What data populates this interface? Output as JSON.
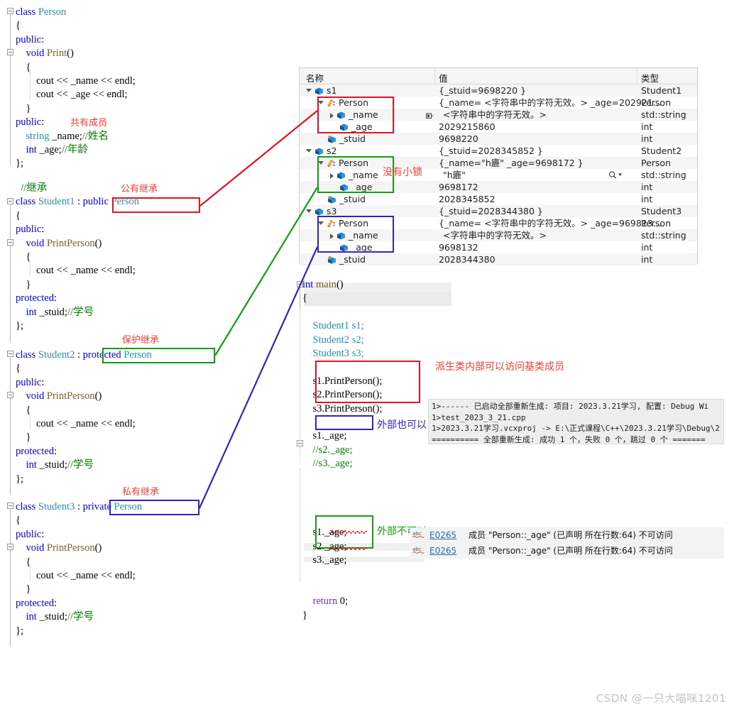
{
  "editor": {
    "left_code_blocks": [
      {
        "id": "person-class",
        "lines": [
          [
            {
              "t": "class ",
              "c": "kw"
            },
            {
              "t": "Person",
              "c": "type"
            }
          ],
          [
            {
              "t": "{",
              "c": "op"
            }
          ],
          [
            {
              "t": "public",
              "c": "kw"
            },
            {
              "t": ":",
              "c": "op"
            }
          ],
          [
            {
              "t": "    ",
              "c": "op"
            },
            {
              "t": "void ",
              "c": "kw"
            },
            {
              "t": "Print",
              "c": "fn"
            },
            {
              "t": "()",
              "c": "op"
            }
          ],
          [
            {
              "t": "    {",
              "c": "op"
            }
          ],
          [
            {
              "t": "        cout ",
              "c": "op"
            },
            {
              "t": "<<",
              "c": "op"
            },
            {
              "t": " _name ",
              "c": "op"
            },
            {
              "t": "<<",
              "c": "op"
            },
            {
              "t": " endl;",
              "c": "op"
            }
          ],
          [
            {
              "t": "        cout ",
              "c": "op"
            },
            {
              "t": "<<",
              "c": "op"
            },
            {
              "t": " _age ",
              "c": "op"
            },
            {
              "t": "<<",
              "c": "op"
            },
            {
              "t": " endl;",
              "c": "op"
            }
          ],
          [
            {
              "t": "    }",
              "c": "op"
            }
          ],
          [
            {
              "t": "public",
              "c": "kw"
            },
            {
              "t": ":",
              "c": "op"
            }
          ],
          [
            {
              "t": "    ",
              "c": "op"
            },
            {
              "t": "string",
              "c": "type"
            },
            {
              "t": " _name;",
              "c": "op"
            },
            {
              "t": "//姓名",
              "c": "cm"
            }
          ],
          [
            {
              "t": "    ",
              "c": "op"
            },
            {
              "t": "int",
              "c": "kw"
            },
            {
              "t": " _age;",
              "c": "op"
            },
            {
              "t": "//年龄",
              "c": "cm"
            }
          ],
          [
            {
              "t": "};",
              "c": "op"
            }
          ]
        ]
      },
      {
        "id": "student1-class",
        "lines": [
          [
            {
              "t": "  //继承",
              "c": "cm"
            }
          ],
          [
            {
              "t": "class ",
              "c": "kw"
            },
            {
              "t": "Student1",
              "c": "type"
            },
            {
              "t": " : ",
              "c": "op"
            },
            {
              "t": "public ",
              "c": "kw"
            },
            {
              "t": "Person",
              "c": "type"
            }
          ],
          [
            {
              "t": "{",
              "c": "op"
            }
          ],
          [
            {
              "t": "public",
              "c": "kw"
            },
            {
              "t": ":",
              "c": "op"
            }
          ],
          [
            {
              "t": "    ",
              "c": "op"
            },
            {
              "t": "void ",
              "c": "kw"
            },
            {
              "t": "PrintPerson",
              "c": "fn"
            },
            {
              "t": "()",
              "c": "op"
            }
          ],
          [
            {
              "t": "    {",
              "c": "op"
            }
          ],
          [
            {
              "t": "        cout ",
              "c": "op"
            },
            {
              "t": "<<",
              "c": "op"
            },
            {
              "t": " _name ",
              "c": "op"
            },
            {
              "t": "<<",
              "c": "op"
            },
            {
              "t": " endl;",
              "c": "op"
            }
          ],
          [
            {
              "t": "    }",
              "c": "op"
            }
          ],
          [
            {
              "t": "protected",
              "c": "kw"
            },
            {
              "t": ":",
              "c": "op"
            }
          ],
          [
            {
              "t": "    ",
              "c": "op"
            },
            {
              "t": "int",
              "c": "kw"
            },
            {
              "t": " _stuid;",
              "c": "op"
            },
            {
              "t": "//学号",
              "c": "cm"
            }
          ],
          [
            {
              "t": "};",
              "c": "op"
            }
          ]
        ]
      },
      {
        "id": "student2-class",
        "lines": [
          [
            {
              "t": "class ",
              "c": "kw"
            },
            {
              "t": "Student2",
              "c": "type"
            },
            {
              "t": " : ",
              "c": "op"
            },
            {
              "t": "protected ",
              "c": "kw"
            },
            {
              "t": "Person",
              "c": "type"
            }
          ],
          [
            {
              "t": "{",
              "c": "op"
            }
          ],
          [
            {
              "t": "public",
              "c": "kw"
            },
            {
              "t": ":",
              "c": "op"
            }
          ],
          [
            {
              "t": "    ",
              "c": "op"
            },
            {
              "t": "void ",
              "c": "kw"
            },
            {
              "t": "PrintPerson",
              "c": "fn"
            },
            {
              "t": "()",
              "c": "op"
            }
          ],
          [
            {
              "t": "    {",
              "c": "op"
            }
          ],
          [
            {
              "t": "        cout ",
              "c": "op"
            },
            {
              "t": "<<",
              "c": "op"
            },
            {
              "t": " _name ",
              "c": "op"
            },
            {
              "t": "<<",
              "c": "op"
            },
            {
              "t": " endl;",
              "c": "op"
            }
          ],
          [
            {
              "t": "    }",
              "c": "op"
            }
          ],
          [
            {
              "t": "protected",
              "c": "kw"
            },
            {
              "t": ":",
              "c": "op"
            }
          ],
          [
            {
              "t": "    ",
              "c": "op"
            },
            {
              "t": "int",
              "c": "kw"
            },
            {
              "t": " _stuid;",
              "c": "op"
            },
            {
              "t": "//学号",
              "c": "cm"
            }
          ],
          [
            {
              "t": "};",
              "c": "op"
            }
          ]
        ]
      },
      {
        "id": "student3-class",
        "lines": [
          [
            {
              "t": "class ",
              "c": "kw"
            },
            {
              "t": "Student3",
              "c": "type"
            },
            {
              "t": " : ",
              "c": "op"
            },
            {
              "t": "private ",
              "c": "kw"
            },
            {
              "t": "Person",
              "c": "type"
            }
          ],
          [
            {
              "t": "{",
              "c": "op"
            }
          ],
          [
            {
              "t": "public",
              "c": "kw"
            },
            {
              "t": ":",
              "c": "op"
            }
          ],
          [
            {
              "t": "    ",
              "c": "op"
            },
            {
              "t": "void ",
              "c": "kw"
            },
            {
              "t": "PrintPerson",
              "c": "fn"
            },
            {
              "t": "()",
              "c": "op"
            }
          ],
          [
            {
              "t": "    {",
              "c": "op"
            }
          ],
          [
            {
              "t": "        cout ",
              "c": "op"
            },
            {
              "t": "<<",
              "c": "op"
            },
            {
              "t": " _name ",
              "c": "op"
            },
            {
              "t": "<<",
              "c": "op"
            },
            {
              "t": " endl;",
              "c": "op"
            }
          ],
          [
            {
              "t": "    }",
              "c": "op"
            }
          ],
          [
            {
              "t": "protected",
              "c": "kw"
            },
            {
              "t": ":",
              "c": "op"
            }
          ],
          [
            {
              "t": "    ",
              "c": "op"
            },
            {
              "t": "int",
              "c": "kw"
            },
            {
              "t": " _stuid;",
              "c": "op"
            },
            {
              "t": "//学号",
              "c": "cm"
            }
          ],
          [
            {
              "t": "};",
              "c": "op"
            }
          ]
        ]
      }
    ],
    "main_block": {
      "signature_int": "int ",
      "signature_name": "main",
      "signature_parens": "()",
      "brace_open": "{",
      "decl1": "Student1 s1;",
      "decl2": "Student2 s2;",
      "decl3": "Student3 s3;",
      "call1": "s1.PrintPerson();",
      "call2": "s2.PrintPerson();",
      "call3": "s3.PrintPerson();",
      "access1": "s1._age;",
      "access2": "//s2._age;",
      "access3": "//s3._age;",
      "access4": "s1._age;",
      "access5": "s2._age;",
      "access6": "s3._age;",
      "return_kw": "return ",
      "return_val": "0;",
      "brace_close": "}"
    }
  },
  "annotations": {
    "public_inherit": "公有继承",
    "protected_inherit": "保护继承",
    "private_inherit": "私有继承",
    "public_member": "共有成员",
    "no_lock": "没有小锁",
    "derived_can_access": "派生类内部可以访问基类成员",
    "outside_can": "外部也可以",
    "outside_cannot": "外部不可以"
  },
  "watch_window": {
    "columns": {
      "name": "名称",
      "value": "值",
      "type": "类型"
    },
    "rows": [
      {
        "indent": 0,
        "exp": "open",
        "icon": "blue-cube",
        "name": "s1",
        "value": "{_stuid=9698220 }",
        "type": "Student1"
      },
      {
        "indent": 1,
        "exp": "open",
        "icon": "base-class",
        "name": "Person",
        "value": "{_name= <字符串中的字符无效。> _age=202921...",
        "type": "Person"
      },
      {
        "indent": 2,
        "exp": "closed",
        "icon": "blue-cube",
        "name": "_name",
        "value": "<字符串中的字符无效。>",
        "type": "std::string",
        "pin": true
      },
      {
        "indent": 2,
        "exp": "none",
        "icon": "blue-cube",
        "name": "_age",
        "value": "2029215860",
        "type": "int"
      },
      {
        "indent": 1,
        "exp": "none",
        "icon": "protected-cube",
        "name": "_stuid",
        "value": "9698220",
        "type": "int"
      },
      {
        "indent": 0,
        "exp": "open",
        "icon": "blue-cube",
        "name": "s2",
        "value": "{_stuid=2028345852 }",
        "type": "Student2"
      },
      {
        "indent": 1,
        "exp": "open",
        "icon": "base-class",
        "name": "Person",
        "value": "{_name=\"h廘\" _age=9698172 }",
        "type": "Person"
      },
      {
        "indent": 2,
        "exp": "closed",
        "icon": "blue-cube",
        "name": "_name",
        "value": "\"h廘\"",
        "type": "std::string",
        "magnifier": true
      },
      {
        "indent": 2,
        "exp": "none",
        "icon": "blue-cube",
        "name": "_age",
        "value": "9698172",
        "type": "int"
      },
      {
        "indent": 1,
        "exp": "none",
        "icon": "protected-cube",
        "name": "_stuid",
        "value": "2028345852",
        "type": "int"
      },
      {
        "indent": 0,
        "exp": "open",
        "icon": "blue-cube",
        "name": "s3",
        "value": "{_stuid=2028344380 }",
        "type": "Student3"
      },
      {
        "indent": 1,
        "exp": "open",
        "icon": "base-class",
        "name": "Person",
        "value": "{_name= <字符串中的字符无效。> _age=969813...",
        "type": "Person"
      },
      {
        "indent": 2,
        "exp": "closed",
        "icon": "blue-cube",
        "name": "_name",
        "value": "<字符串中的字符无效。>",
        "type": "std::string"
      },
      {
        "indent": 2,
        "exp": "none",
        "icon": "blue-cube",
        "name": "_age",
        "value": "9698132",
        "type": "int"
      },
      {
        "indent": 1,
        "exp": "none",
        "icon": "protected-cube",
        "name": "_stuid",
        "value": "2028344380",
        "type": "int"
      }
    ]
  },
  "output_window": {
    "lines": [
      "1>------ 已启动全部重新生成: 项目: 2023.3.21学习, 配置: Debug Wi",
      "1>test_2023_3_21.cpp",
      "1>2023.3.21学习.vcxproj -> E:\\正式课程\\C++\\2023.3.21学习\\Debug\\2",
      "========== 全部重新生成: 成功 1 个，失败 0 个，跳过 0 个 ======="
    ]
  },
  "error_list": {
    "rows": [
      {
        "icon": "squiggle-icon",
        "code": "E0265",
        "message": "成员 \"Person::_age\" (已声明 所在行数:64) 不可访问"
      },
      {
        "icon": "squiggle-icon",
        "code": "E0265",
        "message": "成员 \"Person::_age\" (已声明 所在行数:64) 不可访问"
      }
    ]
  },
  "watermark": "CSDN @一只大喵咪1201",
  "colors": {
    "red": "#e81123",
    "green": "#11a011",
    "blue": "#3521c4",
    "keyword": "#0000ff",
    "type": "#2b91af",
    "comment": "#008000",
    "function": "#795e26",
    "link": "#1d6fb8"
  }
}
